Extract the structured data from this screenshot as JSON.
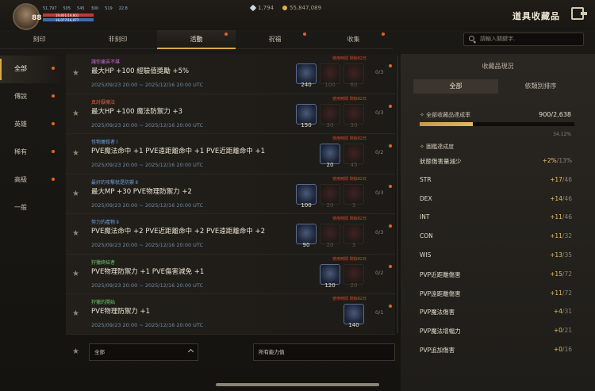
{
  "header": {
    "level": "88",
    "stats": [
      "51,797",
      "505",
      "545",
      "300",
      "519",
      "22.8"
    ],
    "hp_text": "19,801/19,801",
    "mp_text": "16,077/16,077",
    "hp_fraction": 1.0,
    "mp_fraction": 1.0,
    "currency_1": "1,794",
    "currency_2": "55,847,089",
    "title": "道具收藏品",
    "colors": {
      "accent": "#d8a84a",
      "notify": "#e06428",
      "hp": "#c23a34",
      "mp": "#3a6fa8"
    }
  },
  "tabs": [
    {
      "label": "刻印",
      "active": false,
      "dot": false
    },
    {
      "label": "非刻印",
      "active": false,
      "dot": false
    },
    {
      "label": "活動",
      "active": true,
      "dot": true
    },
    {
      "label": "祝福",
      "active": false,
      "dot": true
    },
    {
      "label": "收集",
      "active": false,
      "dot": true
    }
  ],
  "search": {
    "placeholder": "請輸入關鍵字.",
    "icon": "search-icon"
  },
  "sidebar": [
    {
      "label": "全部",
      "active": true,
      "dot": true
    },
    {
      "label": "傳說",
      "active": false,
      "dot": true
    },
    {
      "label": "英雄",
      "active": false,
      "dot": true
    },
    {
      "label": "稀有",
      "active": false,
      "dot": true
    },
    {
      "label": "高級",
      "active": false,
      "dot": true
    },
    {
      "label": "一般",
      "active": false,
      "dot": false
    }
  ],
  "warning_text": "使用時間 剩餘82日",
  "items": [
    {
      "category": "讓你痛苦不堪",
      "cat_color": "#c86ad8",
      "title": "最大HP +100 經驗值獎勵 +5%",
      "date": "2025/09/23 20:00 ~ 2025/12/16 20:00 UTC",
      "slots": [
        {
          "num": "240",
          "on": true
        },
        {
          "num": "100",
          "on": false
        },
        {
          "num": "60",
          "on": false
        }
      ],
      "count": "0/3",
      "warn": true
    },
    {
      "category": "真討厭魔法",
      "cat_color": "#e0603a",
      "title": "最大HP +100 魔法防禦力 +3",
      "date": "2025/09/23 20:00 ~ 2025/12/16 20:00 UTC",
      "slots": [
        {
          "num": "150",
          "on": true
        },
        {
          "num": "30",
          "on": false
        },
        {
          "num": "30",
          "on": false
        }
      ],
      "count": "0/3",
      "warn": true
    },
    {
      "category": "怪物屠殺者 Ⅰ",
      "cat_color": "#6aa0e0",
      "title": "PVE魔法命中 +1 PVE遠距離命中 +1 PVE近距離命中 +1",
      "date": "2025/09/23 20:00 ~ 2025/12/16 20:00 UTC",
      "slots": [
        {
          "num": "20",
          "on": true
        },
        {
          "num": "45",
          "on": false
        }
      ],
      "count": "0/2",
      "warn": true
    },
    {
      "category": "最好的攻擊就是防禦 Ⅱ",
      "cat_color": "#6aa0e0",
      "title": "最大MP +30 PVE物理防禦力 +2",
      "date": "2025/09/23 20:00 ~ 2025/12/16 20:00 UTC",
      "slots": [
        {
          "num": "100",
          "on": true
        },
        {
          "num": "20",
          "on": false
        },
        {
          "num": "3",
          "on": false
        }
      ],
      "count": "0/3",
      "warn": true
    },
    {
      "category": "努力的產物 Ⅱ",
      "cat_color": "#6aa0e0",
      "title": "PVE魔法命中 +2 PVE近距離命中 +2 PVE遠距離命中 +2",
      "date": "2025/09/23 20:00 ~ 2025/12/16 20:00 UTC",
      "slots": [
        {
          "num": "90",
          "on": true
        },
        {
          "num": "20",
          "on": false
        },
        {
          "num": "3",
          "on": false
        }
      ],
      "count": "0/3",
      "warn": true
    },
    {
      "category": "狩獵終結者",
      "cat_color": "#6ac868",
      "title": "PVE物理防禦力 +1 PVE傷害減免 +1",
      "date": "2025/09/23 20:00 ~ 2025/12/16 20:00 UTC",
      "slots": [
        {
          "num": "120",
          "on": true
        },
        {
          "num": "20",
          "on": false
        }
      ],
      "count": "0/2",
      "warn": true
    },
    {
      "category": "狩獵的開始",
      "cat_color": "#6ac868",
      "title": "PVE物理防禦力 +1",
      "date": "2025/09/23 20:00 ~ 2025/12/16 20:00 UTC",
      "slots": [
        {
          "num": "140",
          "on": true
        }
      ],
      "count": "0/1",
      "warn": true
    }
  ],
  "footer": {
    "grade_select": "全部",
    "stat_select": "所有能力值"
  },
  "panel": {
    "title": "收藏品現況",
    "tabs": [
      {
        "label": "全部",
        "active": true
      },
      {
        "label": "依類別排序",
        "active": false
      }
    ],
    "rate_label": "全部收藏品達成率",
    "rate_value": "900/2,638",
    "rate_fraction": 0.3412,
    "rate_percent": "34.12%",
    "section": "圖鑑達成度",
    "stats": [
      {
        "label": "狀態傷害量減少",
        "val": "+2%",
        "max": "/13%"
      },
      {
        "label": "STR",
        "val": "+17",
        "max": "/46"
      },
      {
        "label": "DEX",
        "val": "+14",
        "max": "/46"
      },
      {
        "label": "INT",
        "val": "+11",
        "max": "/46"
      },
      {
        "label": "CON",
        "val": "+11",
        "max": "/32"
      },
      {
        "label": "WIS",
        "val": "+13",
        "max": "/35"
      },
      {
        "label": "PVP近距離傷害",
        "val": "+15",
        "max": "/72"
      },
      {
        "label": "PVP遠距離傷害",
        "val": "+11",
        "max": "/72"
      },
      {
        "label": "PVP魔法傷害",
        "val": "+4",
        "max": "/31"
      },
      {
        "label": "PVP魔法增幅力",
        "val": "+0",
        "max": "/21"
      },
      {
        "label": "PVP追加傷害",
        "val": "+0",
        "max": "/16"
      }
    ]
  }
}
